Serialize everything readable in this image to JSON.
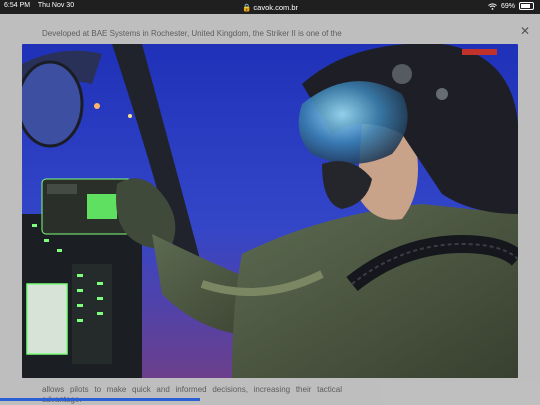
{
  "status_bar": {
    "time": "6:54 PM",
    "date": "Thu Nov 30",
    "url": "cavok.com.br",
    "battery": "69%",
    "battery_level": 0.69,
    "icons": [
      "wifi-icon",
      "lock-icon",
      "battery-icon"
    ]
  },
  "article": {
    "top_text": "Developed at BAE Systems in Rochester, United Kingdom, the Striker II is one of the",
    "bottom_text": "allows pilots to make quick and informed decisions, increasing their tactical advantage."
  },
  "viewer": {
    "close_icon": "close-icon",
    "image_subject": "fighter-pilot-with-helmet-mounted-display-in-cockpit"
  },
  "colors": {
    "sky": "#2a3fc4",
    "dusk": "#6a3a8a",
    "helmet": "#1e1f26",
    "flight_suit": "#4b5743",
    "cockpit_glow": "#7dff7d"
  }
}
